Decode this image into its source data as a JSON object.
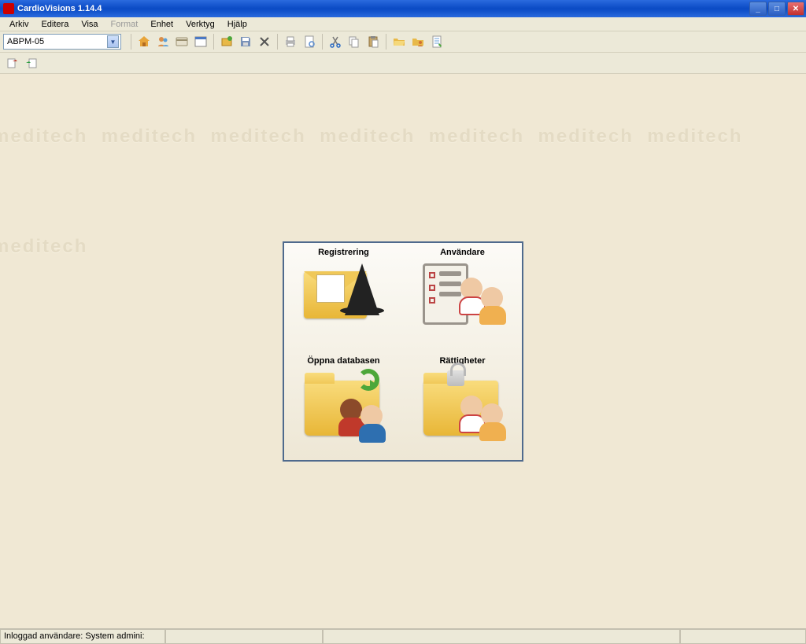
{
  "window": {
    "title": "CardioVisions 1.14.4"
  },
  "menu": {
    "arkiv": "Arkiv",
    "editera": "Editera",
    "visa": "Visa",
    "format": "Format",
    "enhet": "Enhet",
    "verktyg": "Verktyg",
    "hjalp": "Hjälp"
  },
  "toolbar": {
    "device_select": "ABPM-05"
  },
  "panel": {
    "registrering": "Registrering",
    "anvandare": "Användare",
    "oppna_db": "Öppna databasen",
    "rattigheter": "Rättigheter"
  },
  "status": {
    "logged_in": "Inloggad användare: System admini:"
  }
}
